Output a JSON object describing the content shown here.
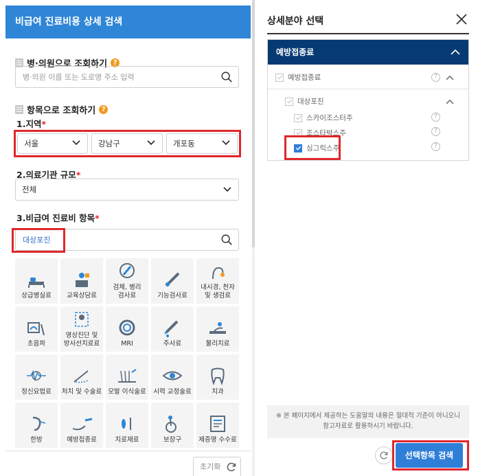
{
  "left": {
    "header_title": "비급여 진료비용 상세 검색",
    "hospital_section": {
      "title": "병·의원으로 조회하기",
      "search_placeholder": "병·의원 이름 또는 도로명 주소 입력"
    },
    "item_section": {
      "title": "항목으로 조회하기",
      "region_label": "1.지역",
      "required_mark": "*",
      "region_values": [
        "서울",
        "강남구",
        "개포동"
      ],
      "scale_label": "2.의료기관 규모",
      "scale_value": "전체",
      "item_label": "3.비급여 진료비 항목",
      "item_search_value": "대상포진"
    },
    "categories": [
      {
        "label": "상급병실료",
        "icon": "hospital-bed-icon"
      },
      {
        "label": "교육상담료",
        "icon": "consultation-icon"
      },
      {
        "label": "검체, 병리\n검사료",
        "icon": "specimen-test-icon"
      },
      {
        "label": "기능검사료",
        "icon": "function-test-icon"
      },
      {
        "label": "내시경, 천자\n및 생검료",
        "icon": "endoscope-icon"
      },
      {
        "label": "초음파",
        "icon": "ultrasound-icon"
      },
      {
        "label": "영상진단 및\n방사선치료료",
        "icon": "radiology-icon"
      },
      {
        "label": "MRI",
        "icon": "mri-icon"
      },
      {
        "label": "주사료",
        "icon": "injection-icon"
      },
      {
        "label": "물리치료",
        "icon": "physical-therapy-icon"
      },
      {
        "label": "정신요법료",
        "icon": "psychotherapy-icon"
      },
      {
        "label": "처치 및 수술료",
        "icon": "surgery-icon"
      },
      {
        "label": "모발 이식술료",
        "icon": "hair-transplant-icon"
      },
      {
        "label": "시력 교정술료",
        "icon": "vision-correction-icon"
      },
      {
        "label": "치과",
        "icon": "tooth-icon"
      },
      {
        "label": "한방",
        "icon": "oriental-medicine-icon"
      },
      {
        "label": "예방접종료",
        "icon": "vaccination-icon"
      },
      {
        "label": "치료재료",
        "icon": "treatment-material-icon"
      },
      {
        "label": "보장구",
        "icon": "wheelchair-icon"
      },
      {
        "label": "제증명 수수료",
        "icon": "certificate-icon"
      }
    ],
    "reset_label": "초기화"
  },
  "right": {
    "title": "상세분야 선택",
    "tree_header": "예방접종료",
    "tree": {
      "root": "예방접종료",
      "group": "대상포진",
      "items": [
        "스카이조스터주",
        "조스타박스주",
        "싱그릭스주"
      ]
    },
    "notice": "※ 본 페이지에서 제공하는 도움말의 내용은 절대적 기준이 아니오니참고자료로 활용하시기 바랍니다.",
    "search_button": "선택항목 검색"
  },
  "colors": {
    "header_blue": "#2f86d6",
    "tree_header_navy": "#063a73",
    "button_blue": "#2f7fd9",
    "highlight_red": "#e0262b",
    "help_orange": "#f29a1e"
  }
}
